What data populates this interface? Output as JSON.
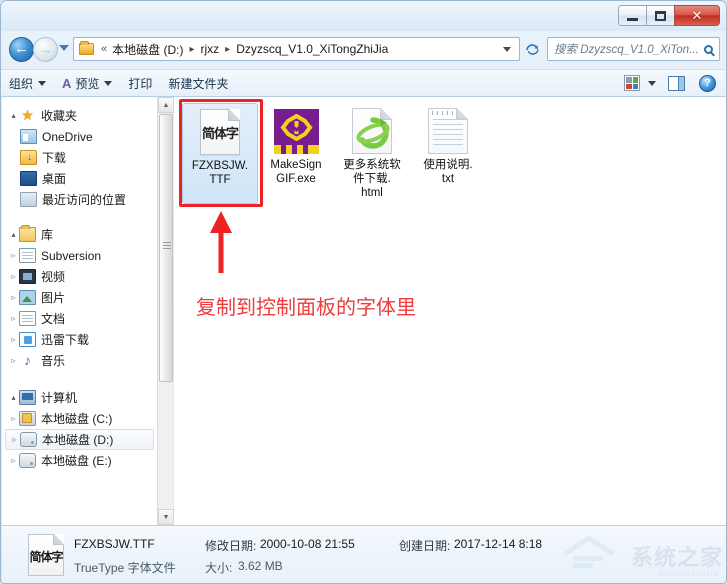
{
  "window": {
    "controls": {
      "minimize": "—",
      "maximize": "▫",
      "close": "✕"
    }
  },
  "address": {
    "back_icon": "back-arrow",
    "forward_icon": "forward-arrow",
    "chevron": "«",
    "crumbs": [
      "本地磁盘 (D:)",
      "rjxz",
      "Dzyzscq_V1.0_XiTongZhiJia"
    ],
    "separator": "▸",
    "refresh_icon": "↯"
  },
  "search": {
    "placeholder": "搜索 Dzyzscq_V1.0_XiTon...",
    "icon": "search-icon"
  },
  "toolbar": {
    "organize": "组织",
    "preview": "预览",
    "print": "打印",
    "new_folder": "新建文件夹",
    "views_icon": "views-icon",
    "preview_pane_icon": "preview-pane-icon",
    "help_icon": "help-icon"
  },
  "sidebar": {
    "groups": [
      {
        "header": {
          "label": "收藏夹",
          "icon": "star-icon",
          "twisty": "▴"
        },
        "items": [
          {
            "label": "OneDrive",
            "icon": "onedrive-icon",
            "twisty": ""
          },
          {
            "label": "下载",
            "icon": "downloads-icon",
            "twisty": ""
          },
          {
            "label": "桌面",
            "icon": "desktop-icon",
            "twisty": ""
          },
          {
            "label": "最近访问的位置",
            "icon": "recent-places-icon",
            "twisty": ""
          }
        ]
      },
      {
        "header": {
          "label": "库",
          "icon": "library-icon",
          "twisty": "▴"
        },
        "items": [
          {
            "label": "Subversion",
            "icon": "document-icon",
            "twisty": "▹"
          },
          {
            "label": "视频",
            "icon": "video-icon",
            "twisty": "▹"
          },
          {
            "label": "图片",
            "icon": "pictures-icon",
            "twisty": "▹"
          },
          {
            "label": "文档",
            "icon": "document-icon",
            "twisty": "▹"
          },
          {
            "label": "迅雷下载",
            "icon": "xunlei-icon",
            "twisty": "▹"
          },
          {
            "label": "音乐",
            "icon": "music-icon",
            "twisty": "▹"
          }
        ]
      },
      {
        "header": {
          "label": "计算机",
          "icon": "computer-icon",
          "twisty": "▴"
        },
        "items": [
          {
            "label": "本地磁盘 (C:)",
            "icon": "system-drive-icon",
            "twisty": "▹"
          },
          {
            "label": "本地磁盘 (D:)",
            "icon": "drive-icon",
            "twisty": "▹",
            "selected": true
          },
          {
            "label": "本地磁盘 (E:)",
            "icon": "drive-icon",
            "twisty": "▹"
          }
        ]
      }
    ],
    "scrollbar": {
      "up": "▲",
      "down": "▼"
    }
  },
  "files": [
    {
      "name": "FZXBSJW.TTF",
      "lines": [
        "FZXBSJW.",
        "TTF"
      ],
      "icon": "font-file-icon",
      "icon_glyph": "简体字",
      "selected": true
    },
    {
      "name": "MakeSignGIF.exe",
      "lines": [
        "MakeSign",
        "GIF.exe"
      ],
      "icon": "application-icon",
      "selected": false
    },
    {
      "name": "更多系统软件下载.html",
      "lines": [
        "更多系统软",
        "件下载.",
        "html"
      ],
      "icon": "html-file-icon",
      "selected": false
    },
    {
      "name": "使用说明.txt",
      "lines": [
        "使用说明.",
        "txt"
      ],
      "icon": "text-file-icon",
      "selected": false
    }
  ],
  "annotation": {
    "text": "复制到控制面板的字体里",
    "color": "#ef3b3b",
    "highlight_target": "FZXBSJW.TTF"
  },
  "status": {
    "icon": "font-file-icon",
    "icon_glyph": "简体字",
    "filename": "FZXBSJW.TTF",
    "modified_label": "修改日期:",
    "modified_value": "2000-10-08 21:55",
    "created_label": "创建日期:",
    "created_value": "2017-12-14 8:18",
    "filetype": "TrueType 字体文件",
    "size_label": "大小:",
    "size_value": "3.62 MB"
  },
  "watermark": {
    "text": "系统之家",
    "sub": "XITONGZHIJIA"
  }
}
